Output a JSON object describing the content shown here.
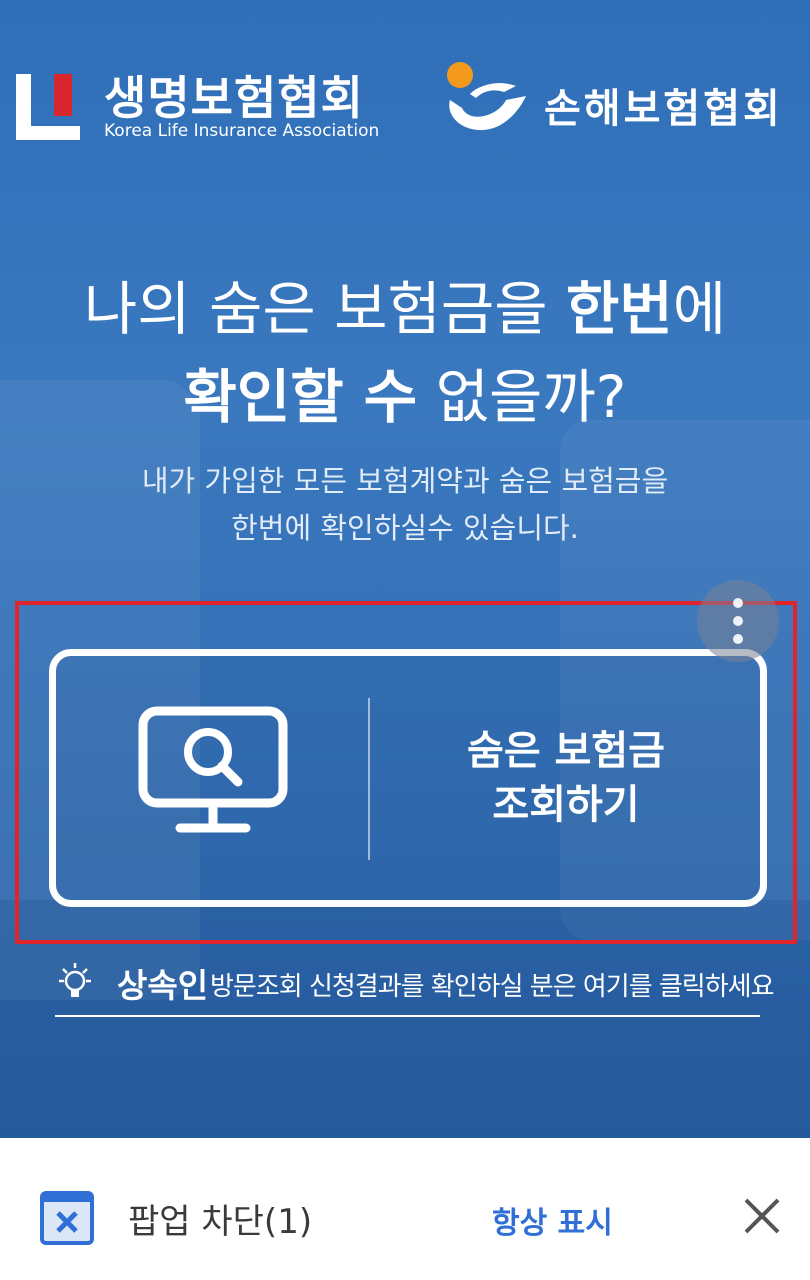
{
  "header": {
    "left_logo": {
      "title": "생명보험협회",
      "subtitle": "Korea Life Insurance Association",
      "icon": "klia-logo-icon",
      "accent": "#d7262d"
    },
    "right_logo": {
      "title": "손해보험협회",
      "icon": "gnl-logo-icon",
      "accent": "#f39a1c"
    }
  },
  "hero": {
    "line1_pre": "나의 숨은 보험금을 ",
    "line1_bold": "한번",
    "line1_post": "에",
    "line2_bold": "확인할 수",
    "line2_post": " 없을까?",
    "sub_line1": "내가 가입한 모든 보험계약과 숨은 보험금을",
    "sub_line2": "한번에 확인하실수 있습니다."
  },
  "search_card": {
    "label_line1": "숨은 보험금",
    "label_line2": "조회하기",
    "icon": "monitor-search-icon",
    "highlight_color": "#e0242c"
  },
  "heir_link": {
    "bold": "상속인",
    "text": "방문조회 신청결과를 확인하실 분은 여기를 클릭하세요",
    "icon": "lightbulb-icon"
  },
  "popup_bar": {
    "text": "팝업 차단(1)",
    "always_show": "항상 표시",
    "icon": "popup-blocked-icon",
    "close_icon": "close-icon",
    "link_color": "#2f6fd6"
  }
}
